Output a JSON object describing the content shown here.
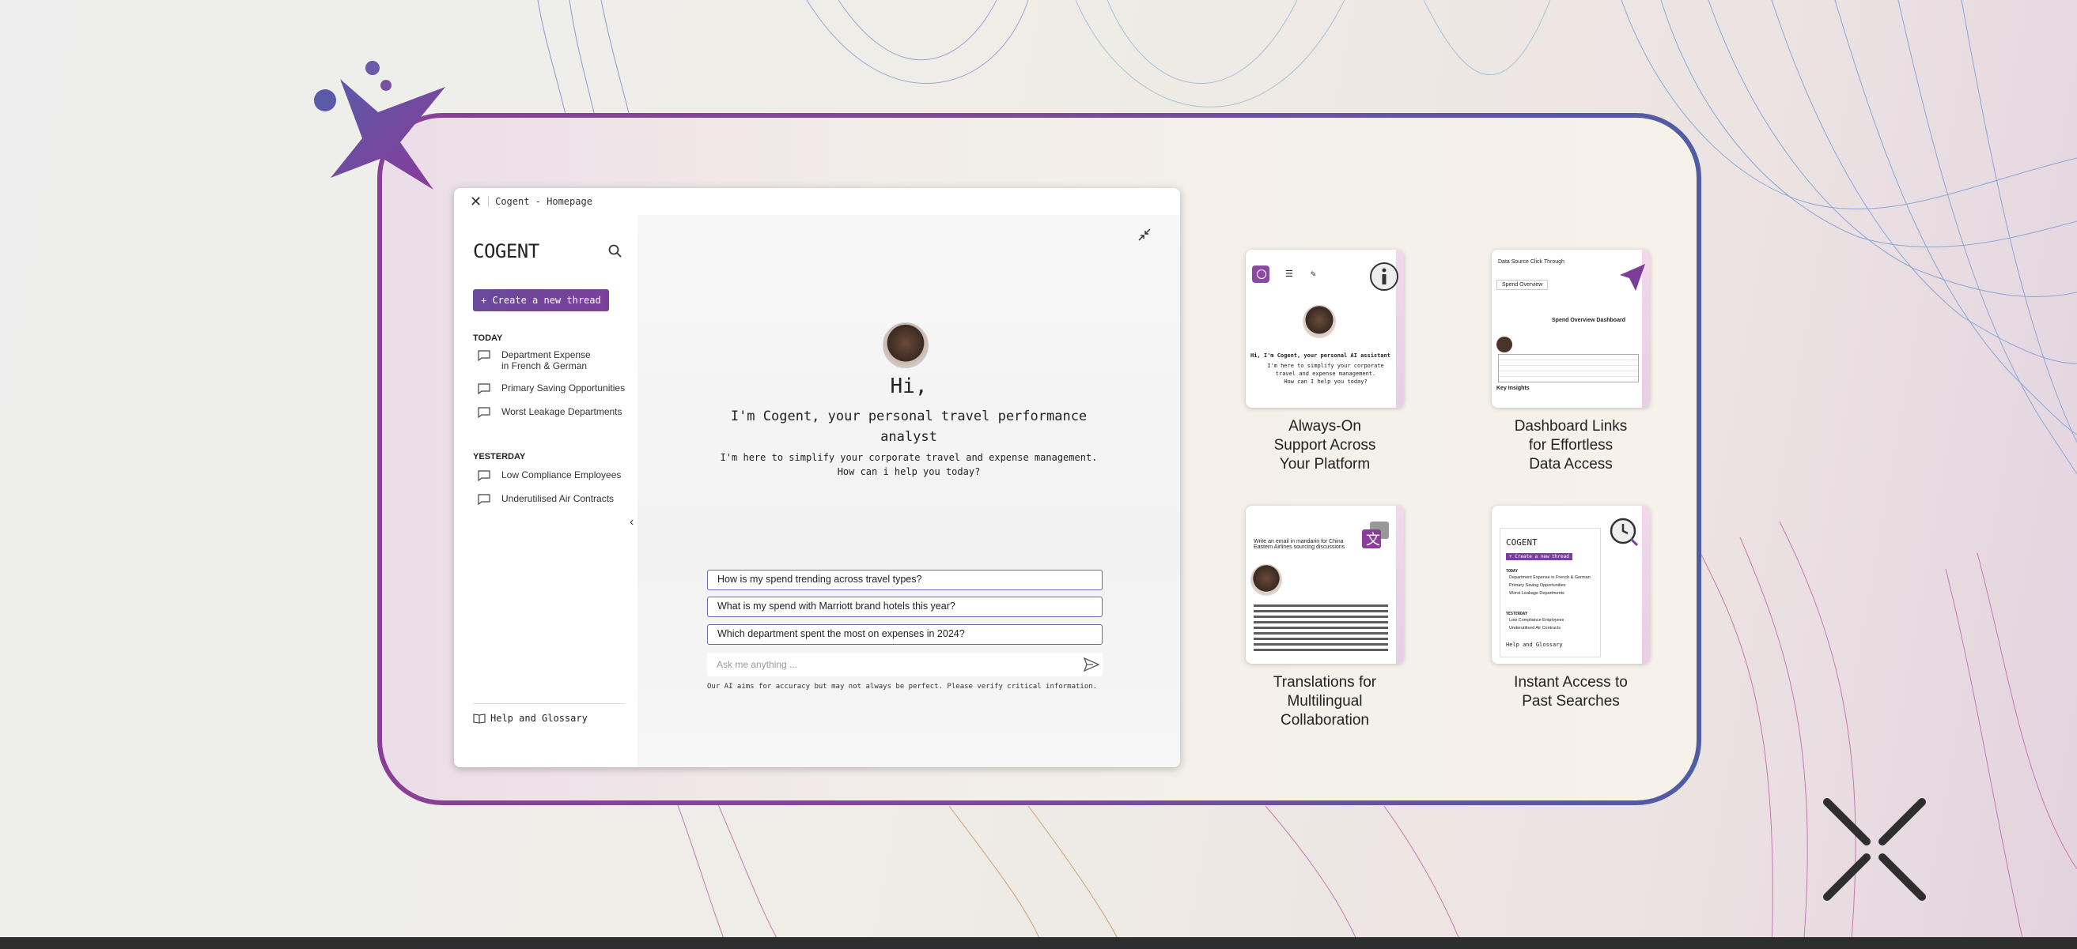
{
  "window": {
    "title": "Cogent - Homepage"
  },
  "sidebar": {
    "brand": "COGENT",
    "new_thread": "+ Create a new thread",
    "today_label": "TODAY",
    "today": [
      {
        "line1": "Department Expense",
        "line2": "in French & German"
      },
      {
        "line1": "Primary Saving Opportunities",
        "line2": ""
      },
      {
        "line1": "Worst Leakage Departments",
        "line2": ""
      }
    ],
    "yesterday_label": "YESTERDAY",
    "yesterday": [
      {
        "line1": "Low Compliance Employees"
      },
      {
        "line1": "Underutilised Air Contracts"
      }
    ],
    "help": "Help and Glossary"
  },
  "main": {
    "hi": "Hi,",
    "intro": "I'm Cogent, your personal travel performance analyst",
    "sub1": "I'm here to simplify your corporate travel and expense management.",
    "sub2": "How can i help you today?",
    "suggestions": [
      "How is my spend trending across travel types?",
      "What is my spend with Marriott brand hotels this year?",
      "Which department spent the most on expenses in 2024?"
    ],
    "ask_placeholder": "Ask me anything ...",
    "disclaimer": "Our AI aims for accuracy but may not always be perfect. Please verify critical information."
  },
  "features": [
    {
      "caption1": "Always-On",
      "caption2": "Support Across",
      "caption3": "Your Platform",
      "icon": "info-icon"
    },
    {
      "caption1": "Dashboard Links",
      "caption2": "for Effortless",
      "caption3": "Data Access",
      "icon": "cursor-click-icon"
    },
    {
      "caption1": "Translations for",
      "caption2": "Multilingual",
      "caption3": "Collaboration",
      "icon": "translate-icon"
    },
    {
      "caption1": "Instant Access to",
      "caption2": "Past Searches",
      "caption3": "",
      "icon": "clock-search-icon"
    }
  ],
  "tile_text": {
    "t1_title": "Hi, I'm Cogent, your personal AI assistant",
    "t1_l1": "I'm here to simplify your corporate",
    "t1_l2": "travel and expense management.",
    "t1_l3": "How can I help you today?",
    "t2_header": "Data Source Click Through",
    "t2_tab": "Spend Overview",
    "t2_dash": "Spend Overview Dashboard",
    "t2_insights": "Key Insights",
    "t3_prompt": "Write an email in mandarin for China Eastern Airlines sourcing discussions",
    "t4_brand": "COGENT",
    "t4_new": "+ Create a new thread",
    "t4_today": "TODAY",
    "t4_items": [
      "Department Expense in French & German",
      "Primary Saving Opportunities",
      "Worst Leakage Departments"
    ],
    "t4_yesterday": "YESTERDAY",
    "t4_items2": [
      "Low Compliance Employees",
      "Underutilised Air Contracts"
    ],
    "t4_help": "Help and Glossary"
  },
  "colors": {
    "accent": "#7b3f9a",
    "border_blue": "#4f5ca4",
    "dark": "#2e2e2e"
  }
}
